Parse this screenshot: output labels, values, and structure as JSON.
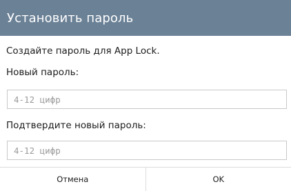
{
  "dialog": {
    "title": "Установить пароль",
    "description": "Создайте пароль для App Lock.",
    "new_password": {
      "label": "Новый пароль:",
      "value": "",
      "placeholder": "4-12 цифр"
    },
    "confirm_password": {
      "label": "Подтвердите новый пароль:",
      "value": "",
      "placeholder": "4-12 цифр"
    },
    "buttons": {
      "cancel_label": "Отмена",
      "ok_label": "OK"
    },
    "colors": {
      "title_bar": "#6b8196",
      "title_text": "#ffffff"
    }
  }
}
